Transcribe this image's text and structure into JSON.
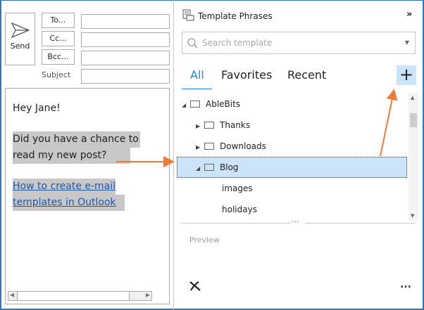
{
  "compose": {
    "send_label": "Send",
    "to_label": "To...",
    "cc_label": "Cc...",
    "bcc_label": "Bcc...",
    "subject_label": "Subject",
    "body": {
      "greeting": "Hey Jane!",
      "line1": "Did you have a chance to",
      "line2": "read my new post?",
      "link1": "How to create e-mail",
      "link2": "templates in Outlook"
    }
  },
  "panel": {
    "title": "Template Phrases",
    "collapse_icon": "double-chevron-right",
    "search_placeholder": "Search template",
    "tabs": [
      {
        "label": "All",
        "active": true
      },
      {
        "label": "Favorites"
      },
      {
        "label": "Recent"
      }
    ],
    "add_label": "+",
    "tree": [
      {
        "label": "AbleBits",
        "expanded": true
      },
      {
        "label": "Thanks"
      },
      {
        "label": "Downloads"
      },
      {
        "label": "Blog",
        "expanded": true,
        "selected": true
      },
      {
        "label": "images"
      },
      {
        "label": "holidays"
      }
    ],
    "splitter": "...",
    "preview_label": "Preview",
    "more_label": "..."
  },
  "colors": {
    "accent": "#1e88e5",
    "selection": "#cce4f7",
    "arrow": "#f07a3c"
  }
}
